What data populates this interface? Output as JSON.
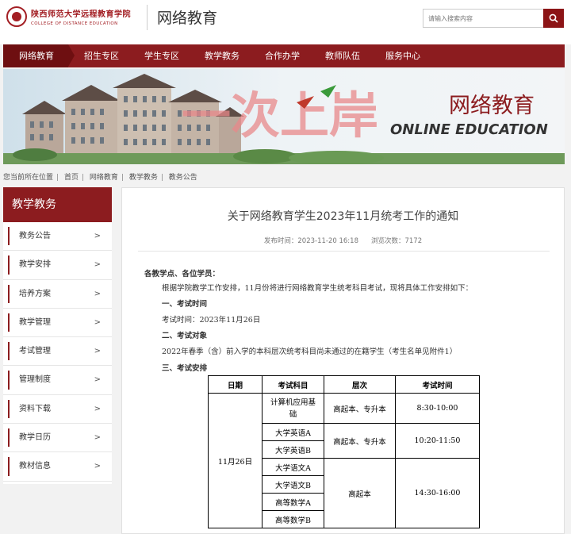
{
  "header": {
    "school_cn": "陕西师范大学远程教育学院",
    "school_en": "COLLEGE OF DISTANCE EDUCATION",
    "site_title": "网络教育",
    "search_placeholder": "请输入搜索内容",
    "search_icon": "search-icon"
  },
  "nav": {
    "items": [
      "网络教育",
      "招生专区",
      "学生专区",
      "教学教务",
      "合作办学",
      "教师队伍",
      "服务中心"
    ]
  },
  "banner": {
    "title_cn": "网络教育",
    "title_en": "ONLINE EDUCATION",
    "watermark": "一次上岸"
  },
  "breadcrumb": {
    "prefix": "您当前所在位置",
    "items": [
      "首页",
      "网络教育",
      "教学教务",
      "教务公告"
    ]
  },
  "sidebar": {
    "title": "教学教务",
    "items": [
      "教务公告",
      "教学安排",
      "培养方案",
      "教学管理",
      "考试管理",
      "管理制度",
      "资料下载",
      "教学日历",
      "教材信息"
    ],
    "arrow": ">"
  },
  "article": {
    "title": "关于网络教育学生2023年11月统考工作的通知",
    "publish_time": "发布时间：2023-11-20 16:18",
    "views": "浏览次数：7172",
    "salutation": "各教学点、各位学员：",
    "intro": "根据学院教学工作安排，11月份将进行网络教育学生统考科目考试，现将具体工作安排如下：",
    "section1": "一、考试时间",
    "exam_time": "考试时间：2023年11月26日",
    "section2": "二、考试对象",
    "target": "2022年春季（含）前入学的本科层次统考科目尚未通过的在籍学生（考生名单见附件1）",
    "section3": "三、考试安排"
  },
  "exam_table": {
    "headers": [
      "日期",
      "考试科目",
      "层次",
      "考试时间"
    ],
    "date": "11月26日",
    "group1": {
      "subject_line1": "计算机应用基",
      "subject_line2": "础",
      "level": "高起本、专升本",
      "time": "8:30-10:00"
    },
    "group2": {
      "subjects": [
        "大学英语A",
        "大学英语B"
      ],
      "level": "高起本、专升本",
      "time": "10:20-11:50"
    },
    "group3": {
      "subjects": [
        "大学语文A",
        "大学语文B",
        "高等数学A",
        "高等数学B"
      ],
      "level": "高起本",
      "time": "14:30-16:00"
    }
  },
  "colors": {
    "brand": "#8c1c1f",
    "brand_dark": "#6e0f11"
  }
}
